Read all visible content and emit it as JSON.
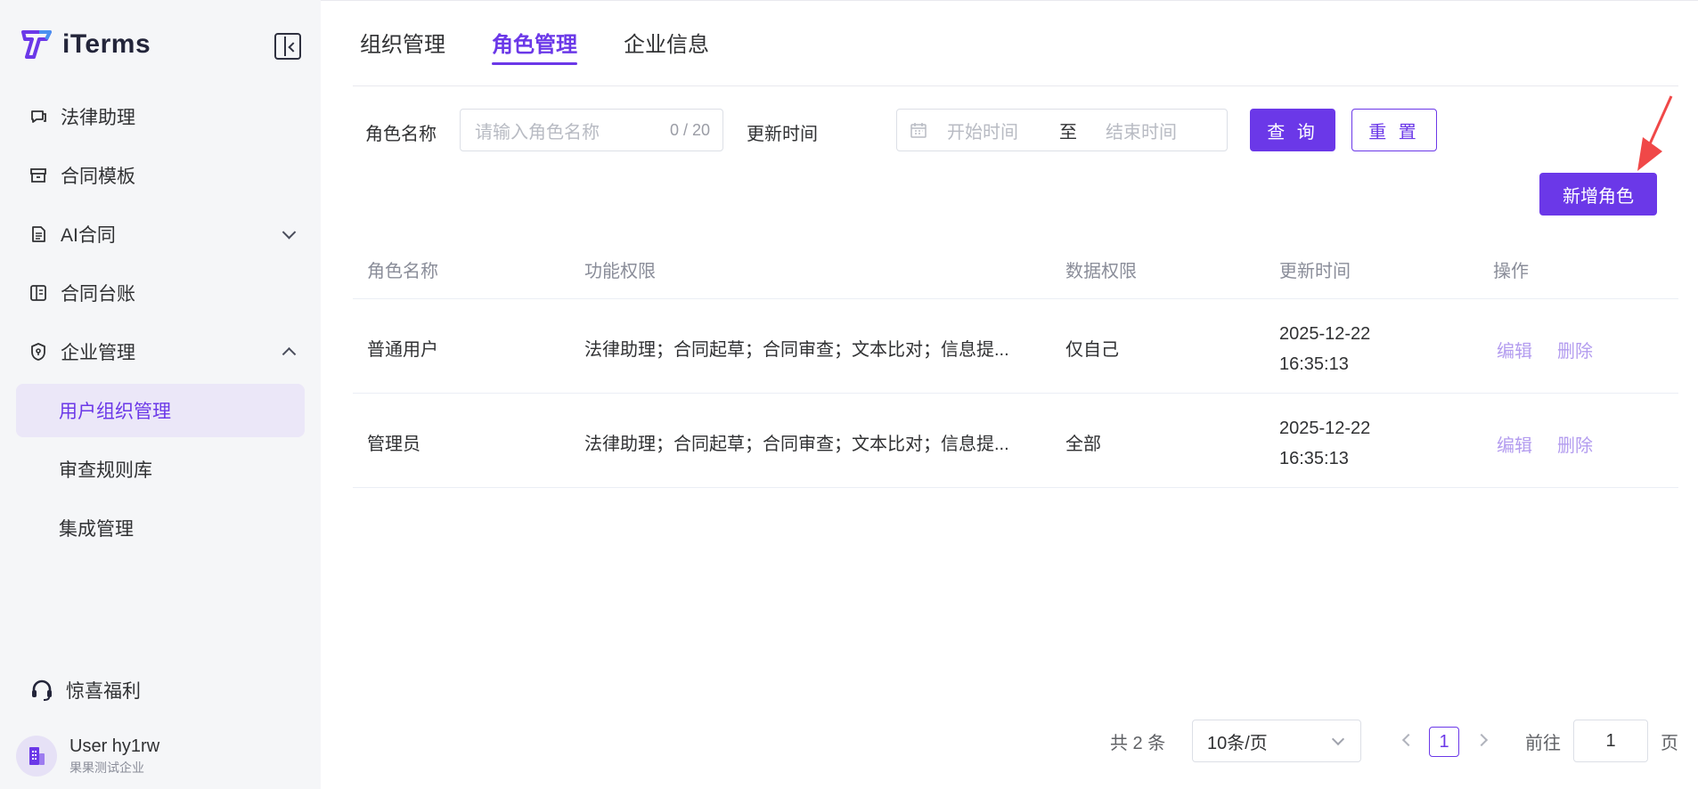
{
  "brand": {
    "name": "iTerms",
    "accent": "#6b38e8"
  },
  "sidebar": {
    "items": [
      {
        "label": "法律助理",
        "icon": "chat-icon"
      },
      {
        "label": "合同模板",
        "icon": "archive-icon"
      },
      {
        "label": "AI合同",
        "icon": "document-icon",
        "expandable": true,
        "expanded": false
      },
      {
        "label": "合同台账",
        "icon": "ledger-icon"
      },
      {
        "label": "企业管理",
        "icon": "shield-icon",
        "expandable": true,
        "expanded": true
      }
    ],
    "sub_items": [
      {
        "label": "用户组织管理",
        "active": true
      },
      {
        "label": "审查规则库"
      },
      {
        "label": "集成管理"
      }
    ],
    "bonus": {
      "label": "惊喜福利",
      "icon": "headset-icon"
    },
    "user": {
      "name": "User hy1rw",
      "org": "果果测试企业",
      "icon": "building-icon"
    }
  },
  "tabs": [
    {
      "label": "组织管理"
    },
    {
      "label": "角色管理",
      "active": true
    },
    {
      "label": "企业信息"
    }
  ],
  "filter": {
    "role_name_label": "角色名称",
    "role_name_placeholder": "请输入角色名称",
    "role_name_count": "0 / 20",
    "update_time_label": "更新时间",
    "start_placeholder": "开始时间",
    "range_separator": "至",
    "end_placeholder": "结束时间",
    "query_label": "查 询",
    "reset_label": "重 置"
  },
  "add_role_label": "新增角色",
  "table": {
    "columns": [
      "角色名称",
      "功能权限",
      "数据权限",
      "更新时间",
      "操作"
    ],
    "rows": [
      {
        "name": "普通用户",
        "functions": "法律助理；合同起草；合同审查；文本比对；信息提...",
        "data_scope": "仅自己",
        "updated_date": "2025-12-22",
        "updated_time": "16:35:13",
        "edit": "编辑",
        "delete": "删除"
      },
      {
        "name": "管理员",
        "functions": "法律助理；合同起草；合同审查；文本比对；信息提...",
        "data_scope": "全部",
        "updated_date": "2025-12-22",
        "updated_time": "16:35:13",
        "edit": "编辑",
        "delete": "删除"
      }
    ]
  },
  "pagination": {
    "total": "共 2 条",
    "page_size": "10条/页",
    "current_page": "1",
    "goto_label": "前往",
    "goto_value": "1",
    "goto_unit": "页"
  }
}
